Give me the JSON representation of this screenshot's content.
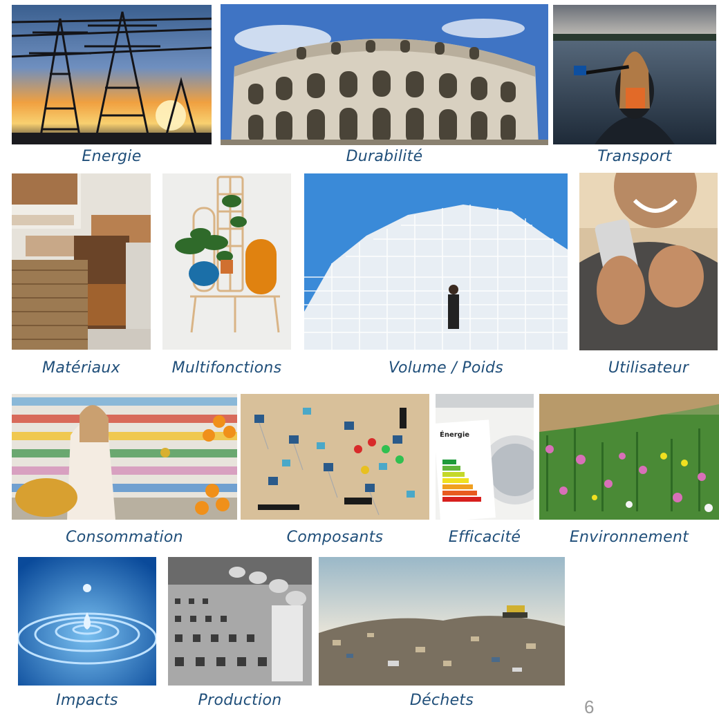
{
  "captions": {
    "energie": "Energie",
    "durabilite": "Durabilité",
    "transport": "Transport",
    "materiaux": "Matériaux",
    "multifonctions": "Multifonctions",
    "volume": "Volume / Poids",
    "utilisateur": "Utilisateur",
    "consommation": "Consommation",
    "composants": "Composants",
    "efficacite": "Efficacité",
    "environnement": "Environnement",
    "impacts": "Impacts",
    "production": "Production",
    "dechets": "Déchets"
  },
  "page_number": "6",
  "energy_label_text": "Énergie",
  "colors": {
    "caption": "#1f4e79"
  }
}
